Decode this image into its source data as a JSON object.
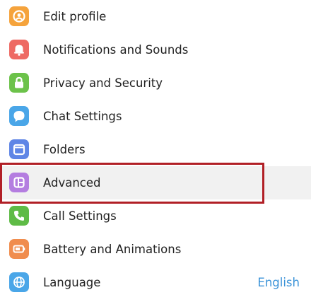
{
  "settings_menu": {
    "items": [
      {
        "label": "Edit profile",
        "icon": "profile-icon",
        "color": "#f5a33c"
      },
      {
        "label": "Notifications and Sounds",
        "icon": "bell-icon",
        "color": "#ee6a64"
      },
      {
        "label": "Privacy and Security",
        "icon": "lock-icon",
        "color": "#6cc24a"
      },
      {
        "label": "Chat Settings",
        "icon": "chat-bubble-icon",
        "color": "#4aa6e8"
      },
      {
        "label": "Folders",
        "icon": "folder-icon",
        "color": "#5f86e6"
      },
      {
        "label": "Advanced",
        "icon": "advanced-icon",
        "color": "#b47de0",
        "selected": true
      },
      {
        "label": "Call Settings",
        "icon": "phone-icon",
        "color": "#5ebb46"
      },
      {
        "label": "Battery and Animations",
        "icon": "battery-icon",
        "color": "#f08d4e"
      },
      {
        "label": "Language",
        "icon": "globe-icon",
        "color": "#4aa6e8",
        "value": "English"
      }
    ],
    "selected_item": "Advanced",
    "highlight_color": "#b11f26",
    "value_color": "#3b93d8",
    "selected_background": "#f1f1f1"
  }
}
